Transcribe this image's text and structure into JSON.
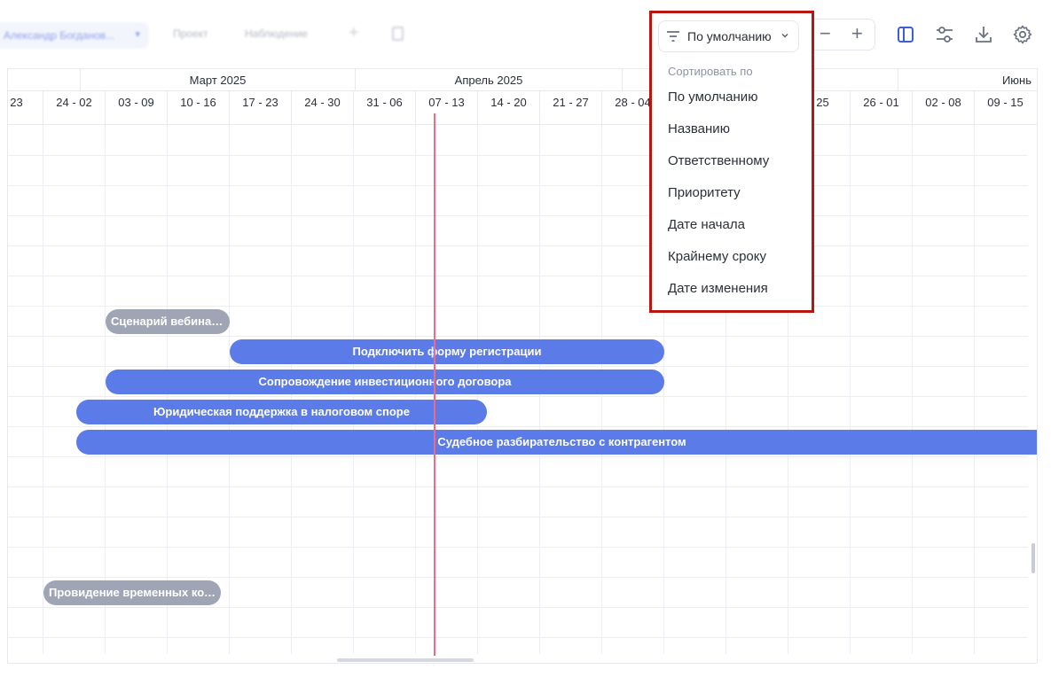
{
  "toolbar": {
    "user_chip": "Александр Богданов...",
    "tab_project": "Проект",
    "tab_watching": "Наблюдение",
    "sort_label": "По умолчанию",
    "zoom_minus": "−",
    "zoom_plus": "+"
  },
  "sort_menu": {
    "header": "Сортировать по",
    "items": [
      "По умолчанию",
      "Названию",
      "Ответственному",
      "Приоритету",
      "Дате начала",
      "Крайнему сроку",
      "Дате изменения"
    ]
  },
  "timeline": {
    "months": [
      "Март 2025",
      "Апрель 2025",
      "Июнь"
    ],
    "weeks": [
      "- 23",
      "24 - 02",
      "03 - 09",
      "10 - 16",
      "17 - 23",
      "24 - 30",
      "31 - 06",
      "07 - 13",
      "14 - 20",
      "21 - 27",
      "28 - 04",
      "",
      "",
      "- 25",
      "26 - 01",
      "02 - 08",
      "09 - 15"
    ]
  },
  "tasks": [
    {
      "name": "Сценарий вебинара",
      "status": "gray"
    },
    {
      "name": "Подключить форму регистрации",
      "status": "blue"
    },
    {
      "name": "Сопровождение инвестиционного договора",
      "status": "blue"
    },
    {
      "name": "Юридическая поддержка в налоговом споре",
      "status": "blue"
    },
    {
      "name": "Судебное разбирательство с контрагентом",
      "status": "blue"
    },
    {
      "name": "Провидение временных ком...",
      "status": "gray"
    }
  ],
  "colors": {
    "bar_blue": "#5a7be8",
    "bar_gray": "#a0a5b6",
    "today_line": "#f06a86",
    "highlight": "#b8170f"
  }
}
